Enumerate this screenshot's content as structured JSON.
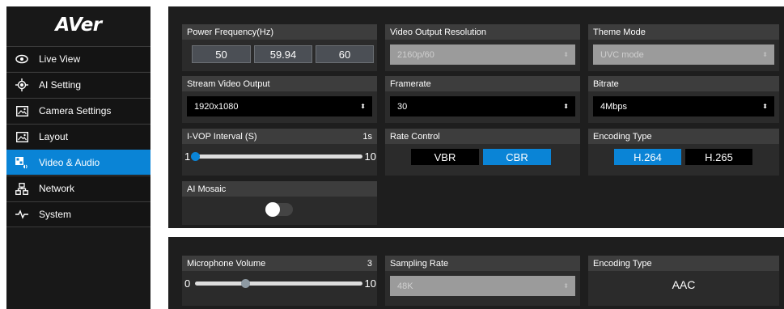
{
  "sidebar": {
    "logo": "AVer",
    "items": [
      {
        "label": "Live View",
        "icon": "eye-icon",
        "active": false
      },
      {
        "label": "AI Setting",
        "icon": "target-icon",
        "active": false
      },
      {
        "label": "Camera Settings",
        "icon": "image-icon",
        "active": false
      },
      {
        "label": "Layout",
        "icon": "layout-icon",
        "active": false
      },
      {
        "label": "Video & Audio",
        "icon": "video-audio-icon",
        "active": true
      },
      {
        "label": "Network",
        "icon": "network-icon",
        "active": false
      },
      {
        "label": "System",
        "icon": "pulse-icon",
        "active": false
      }
    ]
  },
  "video": {
    "power_frequency": {
      "title": "Power Frequency(Hz)",
      "options": [
        "50",
        "59.94",
        "60"
      ]
    },
    "output_resolution": {
      "title": "Video Output Resolution",
      "value": "2160p/60",
      "disabled": true
    },
    "theme_mode": {
      "title": "Theme Mode",
      "value": "UVC mode",
      "disabled": true
    },
    "stream_output": {
      "title": "Stream Video Output",
      "value": "1920x1080"
    },
    "framerate": {
      "title": "Framerate",
      "value": "30"
    },
    "bitrate": {
      "title": "Bitrate",
      "value": "4Mbps"
    },
    "ivop": {
      "title": "I-VOP Interval (S)",
      "current": "1s",
      "min": "1",
      "max": "10",
      "level": 0.0
    },
    "rate_control": {
      "title": "Rate Control",
      "options": [
        "VBR",
        "CBR"
      ],
      "selected": "CBR"
    },
    "encoding_type": {
      "title": "Encoding Type",
      "options": [
        "H.264",
        "H.265"
      ],
      "selected": "H.264"
    },
    "ai_mosaic": {
      "title": "AI Mosaic",
      "enabled": false
    }
  },
  "audio": {
    "mic_volume": {
      "title": "Microphone Volume",
      "current": "3",
      "min": "0",
      "max": "10",
      "level": 0.3
    },
    "sampling_rate": {
      "title": "Sampling Rate",
      "value": "48K",
      "disabled": true
    },
    "encoding_type": {
      "title": "Encoding Type",
      "value": "AAC"
    }
  },
  "colors": {
    "accent": "#0a84d6",
    "panel": "#2b2b2b",
    "panel_header": "#3d3d3d",
    "background": "#1e1e1e"
  }
}
